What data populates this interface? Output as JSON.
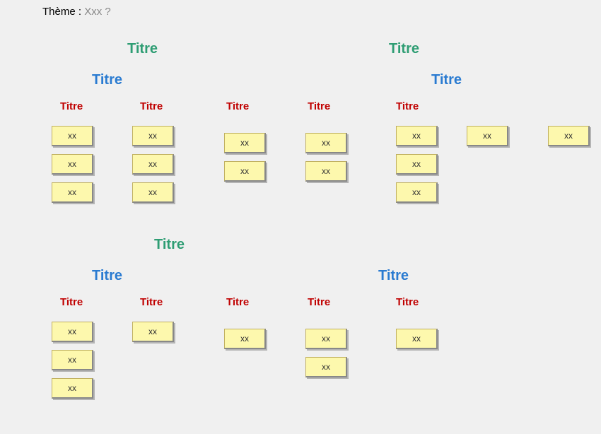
{
  "theme": {
    "label": "Thème : ",
    "value": "Xxx ?"
  },
  "titles": {
    "lvl1_a": "Titre",
    "lvl1_b": "Titre",
    "lvl1_c": "Titre",
    "lvl2_a": "Titre",
    "lvl2_b": "Titre",
    "lvl2_c": "Titre",
    "lvl2_d": "Titre",
    "lvl3_a1": "Titre",
    "lvl3_a2": "Titre",
    "lvl3_a3": "Titre",
    "lvl3_a4": "Titre",
    "lvl3_a5": "Titre",
    "lvl3_c1": "Titre",
    "lvl3_c2": "Titre",
    "lvl3_c3": "Titre",
    "lvl3_c4": "Titre",
    "lvl3_c5": "Titre"
  },
  "cards": {
    "a1_1": "xx",
    "a1_2": "xx",
    "a1_3": "xx",
    "a2_1": "xx",
    "a2_2": "xx",
    "a2_3": "xx",
    "a3_1": "xx",
    "a3_2": "xx",
    "a4_1": "xx",
    "a4_2": "xx",
    "a5_1": "xx",
    "a5_2": "xx",
    "a5_3": "xx",
    "b1": "xx",
    "b2": "xx",
    "c1_1": "xx",
    "c1_2": "xx",
    "c1_3": "xx",
    "c2_1": "xx",
    "c3_1": "xx",
    "c4_1": "xx",
    "c4_2": "xx",
    "c5_1": "xx"
  }
}
